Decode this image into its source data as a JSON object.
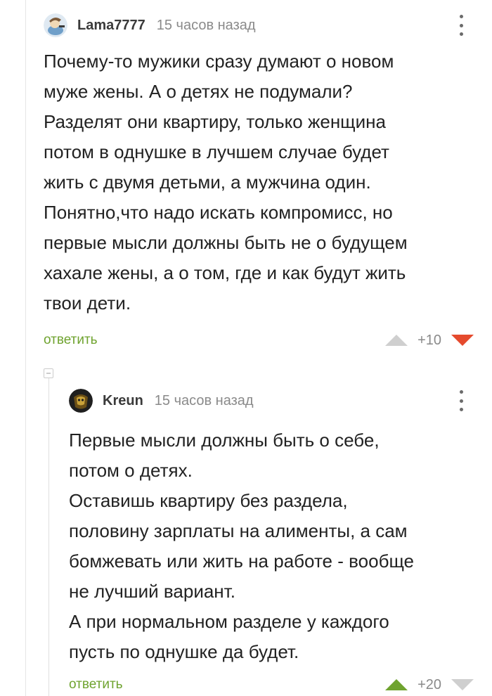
{
  "comments": [
    {
      "username": "Lama7777",
      "time": "15 часов назад",
      "text": "Почему-то мужики сразу думают о новом\nмуже жены. А о детях не подумали?\nРазделят они квартиру, только женщина\nпотом в однушке в лучшем случае будет\nжить с двумя детьми, а мужчина один.\nПонятно,что надо искать компромисс, но\nпервые мысли должны быть не о будущем\nхахале жены, а о том, где и как будут жить\nтвои дети.",
      "reply_label": "ответить",
      "rating": "+10",
      "avatar_icon": "cartoon-character-avatar",
      "vote": "down"
    },
    {
      "username": "Kreun",
      "time": "15 часов назад",
      "text": "Первые мысли должны быть о себе,\nпотом о детях.\nОставишь квартиру без раздела,\nполовину зарплаты на алименты, а сам\nбомжевать или жить на работе - вообще\nне лучший вариант.\nА при нормальном разделе у каждого\nпусть по однушке да будет.",
      "reply_label": "ответить",
      "rating": "+20",
      "avatar_icon": "dark-character-avatar",
      "vote": "up"
    }
  ],
  "colors": {
    "accent_green": "#6fa32f",
    "downvote_red": "#e54a2d",
    "muted_gray": "#8a8a8a"
  }
}
